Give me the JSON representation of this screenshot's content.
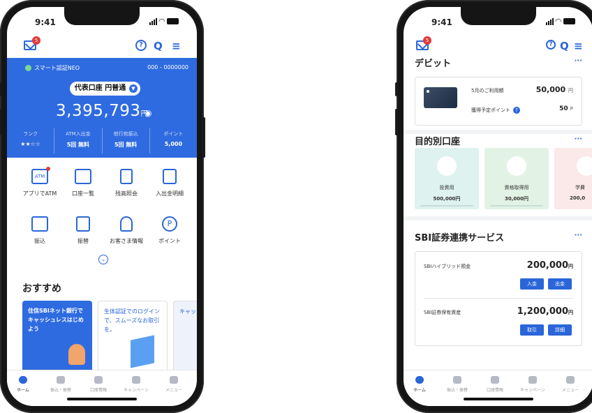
{
  "status_time": "9:41",
  "phone1": {
    "mail_badge": "5",
    "account": {
      "service": "スマート認証NEO",
      "number": "000 - 0000000",
      "account_type": "代表口座 円普通",
      "balance": "3,395,793",
      "currency": "円"
    },
    "stats": [
      {
        "label": "ランク",
        "value": "★★☆☆"
      },
      {
        "label": "ATM入出金",
        "value": "5回 無料"
      },
      {
        "label": "他行宛振込",
        "value": "5回 無料"
      },
      {
        "label": "ポイント",
        "value": "5,000"
      }
    ],
    "menu": [
      {
        "label": "アプリでATM",
        "icon": "ATM"
      },
      {
        "label": "口座一覧",
        "icon": ""
      },
      {
        "label": "残高照会",
        "icon": ""
      },
      {
        "label": "入出金明細",
        "icon": ""
      },
      {
        "label": "振込",
        "icon": ""
      },
      {
        "label": "振替",
        "icon": ""
      },
      {
        "label": "お客さま情報",
        "icon": ""
      },
      {
        "label": "ポイント",
        "icon": "P"
      }
    ],
    "recommend_title": "おすすめ",
    "promos": [
      {
        "text": "住信SBIネット銀行でキャッシュレスはじめよう"
      },
      {
        "text": "生体認証でのログインで、スムーズなお取引を。"
      },
      {
        "text": "キャッシアプリで"
      }
    ]
  },
  "phone2": {
    "mail_badge": "5",
    "debit_title": "デビット",
    "debit_month_label": "5月のご利用額",
    "debit_month_value": "50,000",
    "debit_month_unit": "円",
    "debit_points_label": "獲得予定ポイント",
    "debit_points_value": "50",
    "debit_points_unit": "P",
    "purpose_title": "目的別口座",
    "purposes": [
      {
        "name": "投資用",
        "amount": "500,000円"
      },
      {
        "name": "資格取得用",
        "amount": "30,000円"
      },
      {
        "name": "学費",
        "amount": "200,0"
      }
    ],
    "sbi_title": "SBI証券連携サービス",
    "sbi_hybrid_label": "SBIハイブリッド預金",
    "sbi_hybrid_value": "200,000",
    "sbi_assets_label": "SBI証券保有資産",
    "sbi_assets_value": "1,200,000",
    "yen": "円",
    "deposit_btn": "入金",
    "withdraw_btn": "出金",
    "trade_btn": "取引",
    "detail_btn": "詳細"
  },
  "tabs": [
    "ホーム",
    "振込・振替",
    "口座情報",
    "キャンペーン",
    "メニュー"
  ],
  "colors": {
    "accent": "#2f6be0",
    "badge": "#e23a3a"
  }
}
